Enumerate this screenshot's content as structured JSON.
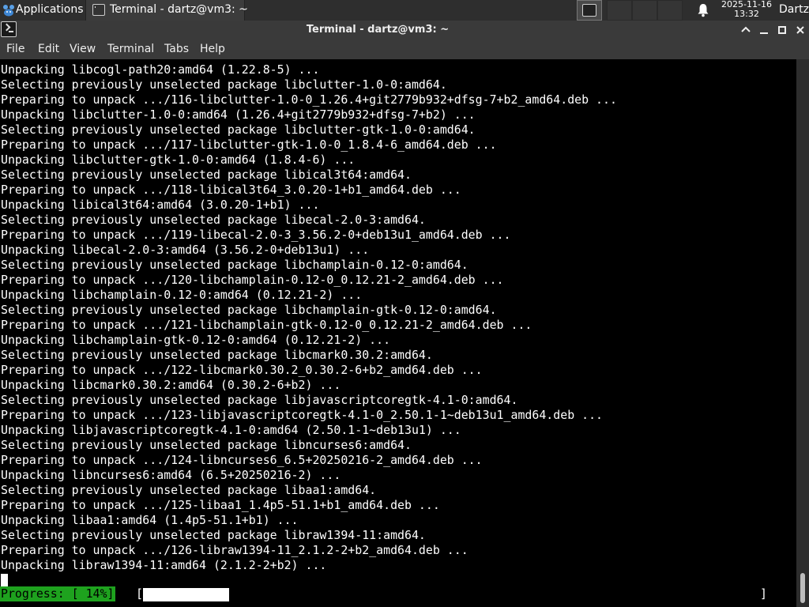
{
  "panel": {
    "apps_label": "Applications",
    "task_label": "Terminal - dartz@vm3: ~",
    "clock_date": "2025-11-16",
    "clock_time": "13:32",
    "user": "Dartz"
  },
  "window": {
    "title": "Terminal - dartz@vm3: ~"
  },
  "menu": [
    "File",
    "Edit",
    "View",
    "Terminal",
    "Tabs",
    "Help"
  ],
  "terminal": {
    "lines": [
      "Unpacking libcogl-path20:amd64 (1.22.8-5) ...",
      "Selecting previously unselected package libclutter-1.0-0:amd64.",
      "Preparing to unpack .../116-libclutter-1.0-0_1.26.4+git2779b932+dfsg-7+b2_amd64.deb ...",
      "Unpacking libclutter-1.0-0:amd64 (1.26.4+git2779b932+dfsg-7+b2) ...",
      "Selecting previously unselected package libclutter-gtk-1.0-0:amd64.",
      "Preparing to unpack .../117-libclutter-gtk-1.0-0_1.8.4-6_amd64.deb ...",
      "Unpacking libclutter-gtk-1.0-0:amd64 (1.8.4-6) ...",
      "Selecting previously unselected package libical3t64:amd64.",
      "Preparing to unpack .../118-libical3t64_3.0.20-1+b1_amd64.deb ...",
      "Unpacking libical3t64:amd64 (3.0.20-1+b1) ...",
      "Selecting previously unselected package libecal-2.0-3:amd64.",
      "Preparing to unpack .../119-libecal-2.0-3_3.56.2-0+deb13u1_amd64.deb ...",
      "Unpacking libecal-2.0-3:amd64 (3.56.2-0+deb13u1) ...",
      "Selecting previously unselected package libchamplain-0.12-0:amd64.",
      "Preparing to unpack .../120-libchamplain-0.12-0_0.12.21-2_amd64.deb ...",
      "Unpacking libchamplain-0.12-0:amd64 (0.12.21-2) ...",
      "Selecting previously unselected package libchamplain-gtk-0.12-0:amd64.",
      "Preparing to unpack .../121-libchamplain-gtk-0.12-0_0.12.21-2_amd64.deb ...",
      "Unpacking libchamplain-gtk-0.12-0:amd64 (0.12.21-2) ...",
      "Selecting previously unselected package libcmark0.30.2:amd64.",
      "Preparing to unpack .../122-libcmark0.30.2_0.30.2-6+b2_amd64.deb ...",
      "Unpacking libcmark0.30.2:amd64 (0.30.2-6+b2) ...",
      "Selecting previously unselected package libjavascriptcoregtk-4.1-0:amd64.",
      "Preparing to unpack .../123-libjavascriptcoregtk-4.1-0_2.50.1-1~deb13u1_amd64.deb ...",
      "Unpacking libjavascriptcoregtk-4.1-0:amd64 (2.50.1-1~deb13u1) ...",
      "Selecting previously unselected package libncurses6:amd64.",
      "Preparing to unpack .../124-libncurses6_6.5+20250216-2_amd64.deb ...",
      "Unpacking libncurses6:amd64 (6.5+20250216-2) ...",
      "Selecting previously unselected package libaa1:amd64.",
      "Preparing to unpack .../125-libaa1_1.4p5-51.1+b1_amd64.deb ...",
      "Unpacking libaa1:amd64 (1.4p5-51.1+b1) ...",
      "Selecting previously unselected package libraw1394-11:amd64.",
      "Preparing to unpack .../126-libraw1394-11_2.1.2-2+b2_amd64.deb ...",
      "Unpacking libraw1394-11:amd64 (2.1.2-2+b2) ..."
    ],
    "progress_label": "Progress: [ 14%]",
    "progress_fraction": 0.14,
    "bracket_open": "[",
    "bracket_close": "]"
  },
  "colors": {
    "progress_label_bg": "#1ea21e",
    "panel_bg": "#2e2e2e",
    "titlebar_bg": "#3a3a3a"
  },
  "icons": {
    "apps": "xfce-mouse-icon",
    "task": "terminal-icon",
    "notifications": "bell-icon"
  }
}
